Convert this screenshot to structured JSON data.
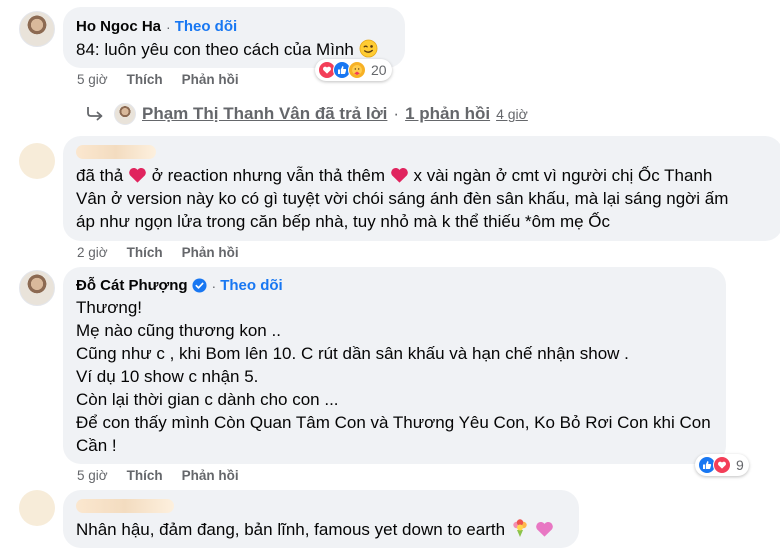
{
  "labels": {
    "follow": "Theo dõi",
    "like": "Thích",
    "reply": "Phản hồi",
    "dot": "·"
  },
  "comments": [
    {
      "author": "Ho Ngoc Ha",
      "text_lines": [
        "84: luôn yêu con theo cách của Mình"
      ],
      "time": "5 giờ",
      "reaction_count": "20",
      "reaction_icons": [
        "heart-icon",
        "like-icon",
        "care-icon"
      ]
    },
    {
      "author": "",
      "text_lines": [
        "đã thả",
        "ở reaction nhưng vẫn thả thêm",
        "x vài ngàn ở cmt vì người chị Ốc Thanh",
        "Vân ở version này ko có gì tuyệt vời chói sáng ánh đèn sân khấu, mà lại sáng ngời ấm",
        "áp như ngọn lửa trong căn bếp nhà, tuy nhỏ mà k thể thiếu *ôm mẹ Ốc"
      ],
      "time": "2 giờ"
    },
    {
      "author": "Đỗ Cát Phượng",
      "verified": true,
      "text_lines": [
        "Thương!",
        "Mẹ nào cũng thương kon ..",
        "Cũng như c , khi Bom lên 10. C rút dần sân khấu và hạn chế nhận show .",
        "Ví dụ 10 show c nhận 5.",
        "Còn lại thời gian c dành cho con ...",
        "Để con thấy mình Còn Quan Tâm Con và Thương Yêu Con, Ko Bỏ Rơi Con khi Con",
        "Cần !"
      ],
      "time": "5 giờ",
      "reaction_count": "9",
      "reaction_icons": [
        "like-icon",
        "heart-icon"
      ]
    },
    {
      "author": "",
      "text_lines": [
        "Nhân hậu, đảm đang, bản lĩnh, famous yet down to earth"
      ]
    }
  ],
  "reply_summary": {
    "replier": "Phạm Thị Thanh Vân đã trả lời",
    "dot": "·",
    "count": "1 phản hồi",
    "time": "4 giờ"
  },
  "colors": {
    "bubble": "#f0f2f5",
    "link_blue": "#1877f2",
    "meta_gray": "#65676b",
    "heart_red": "#f33e58"
  }
}
